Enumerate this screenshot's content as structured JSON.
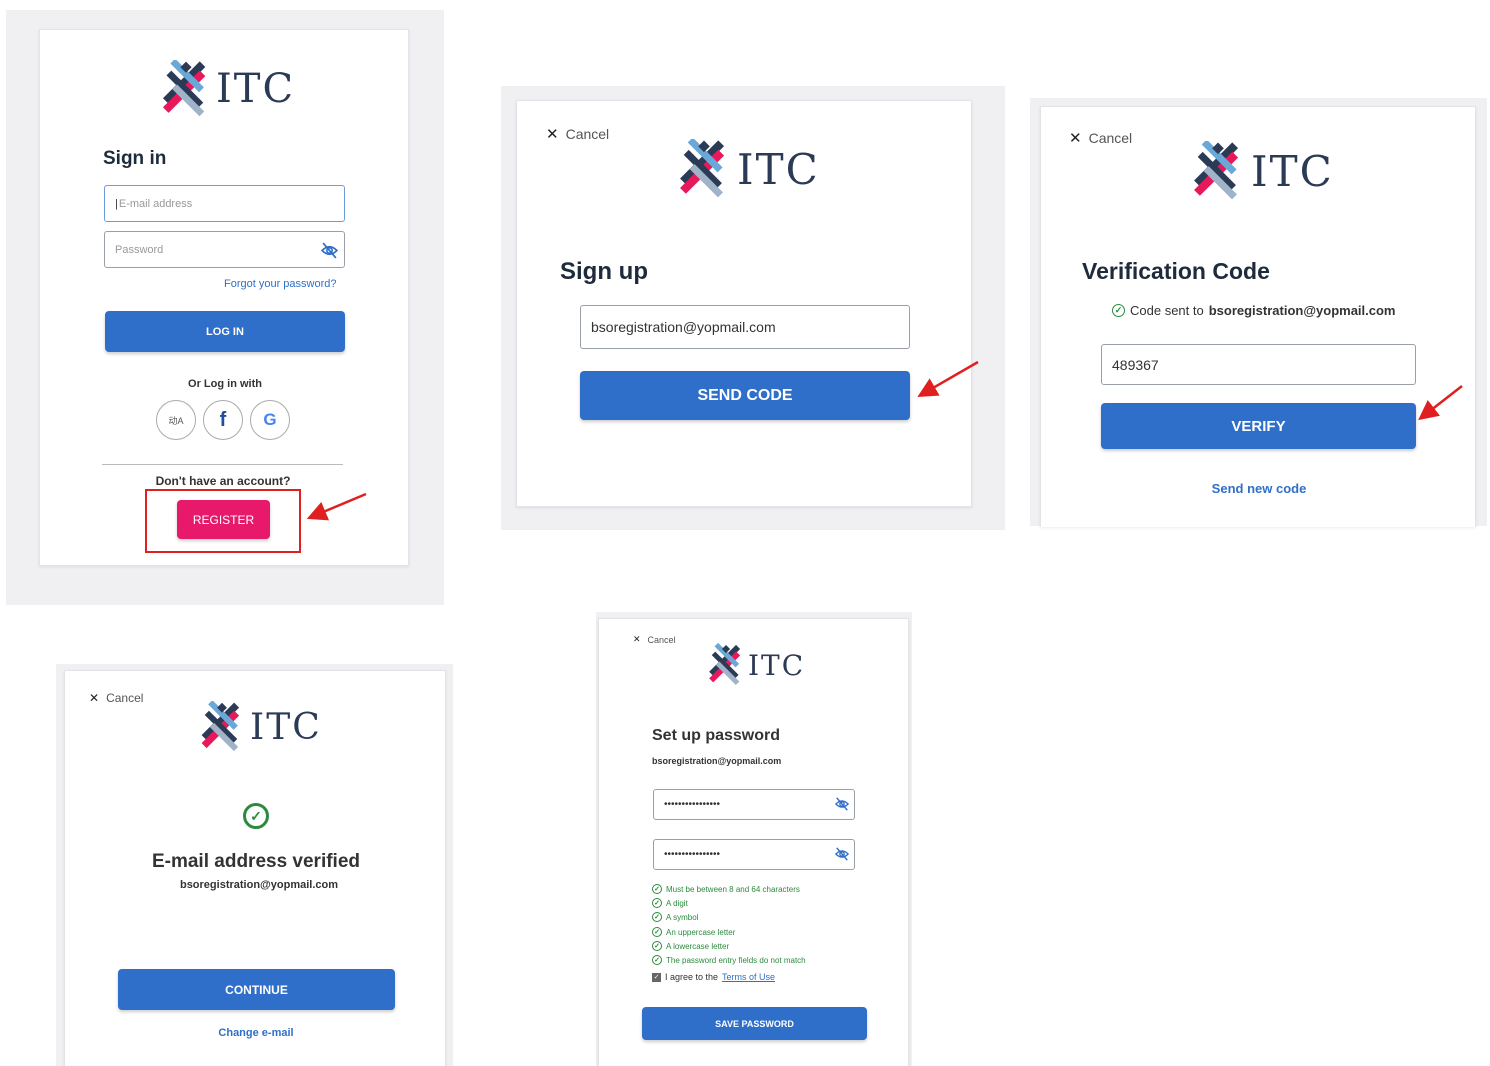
{
  "colors": {
    "primary": "#2f6fc9",
    "register": "#e8196b",
    "success": "#2b8a3e",
    "highlight": "#e02020"
  },
  "signin": {
    "brand": "ITC",
    "title": "Sign in",
    "email_placeholder": "E-mail address",
    "password_placeholder": "Password",
    "forgot": "Forgot your password?",
    "login": "LOG IN",
    "or_with": "Or Log in with",
    "social": [
      "WeChat",
      "Facebook",
      "Google"
    ],
    "no_account": "Don't have an account?",
    "register": "REGISTER"
  },
  "signup": {
    "cancel": "Cancel",
    "brand": "ITC",
    "title": "Sign up",
    "email_value": "bsoregistration@yopmail.com",
    "send_code": "SEND CODE"
  },
  "verify": {
    "cancel": "Cancel",
    "brand": "ITC",
    "title": "Verification Code",
    "sent_prefix": "Code sent to",
    "sent_email": "bsoregistration@yopmail.com",
    "code_value": "489367",
    "verify": "VERIFY",
    "new_code": "Send new code"
  },
  "verified": {
    "cancel": "Cancel",
    "brand": "ITC",
    "title": "E-mail address verified",
    "email": "bsoregistration@yopmail.com",
    "continue": "CONTINUE",
    "change": "Change e-mail"
  },
  "setpw": {
    "cancel": "Cancel",
    "brand": "ITC",
    "title": "Set up password",
    "email": "bsoregistration@yopmail.com",
    "pw1": "••••••••••••••••",
    "pw2": "••••••••••••••••",
    "requirements": [
      "Must be between 8 and 64 characters",
      "A digit",
      "A symbol",
      "An uppercase letter",
      "A lowercase letter",
      "The password entry fields do not match"
    ],
    "agree_prefix": "I agree to the",
    "terms": "Terms of Use",
    "save": "SAVE PASSWORD"
  }
}
